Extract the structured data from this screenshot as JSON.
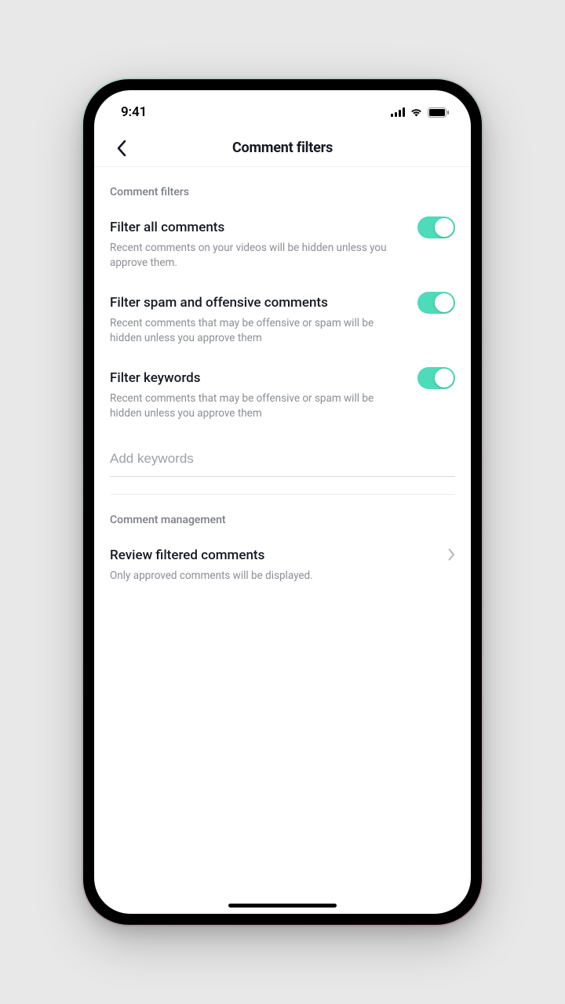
{
  "status": {
    "time": "9:41"
  },
  "header": {
    "title": "Comment filters"
  },
  "sections": {
    "filters": {
      "header": "Comment filters",
      "items": [
        {
          "title": "Filter all comments",
          "desc": "Recent comments on your videos will be hidden unless you approve them.",
          "on": true
        },
        {
          "title": "Filter spam and offensive comments",
          "desc": "Recent comments that may be offensive or spam will be hidden unless you approve them",
          "on": true
        },
        {
          "title": "Filter keywords",
          "desc": "Recent comments that may be offensive or spam will be hidden unless you approve them",
          "on": true
        }
      ],
      "keyword_input": {
        "placeholder": "Add keywords",
        "value": ""
      }
    },
    "management": {
      "header": "Comment management",
      "review": {
        "title": "Review filtered comments",
        "desc": "Only approved comments will be displayed."
      }
    }
  },
  "colors": {
    "accent": "#4ddbb9"
  }
}
